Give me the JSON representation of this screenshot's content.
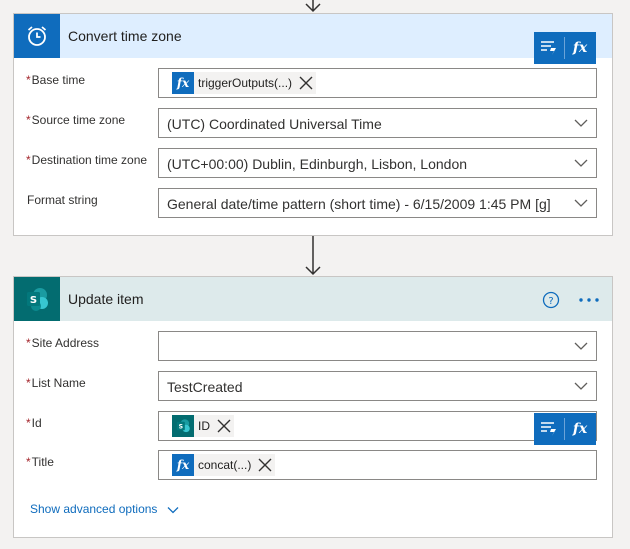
{
  "convert": {
    "title": "Convert time zone",
    "icon": "alarm-clock-icon",
    "accent": "#0f6cbd",
    "header_bg": "#deeeff",
    "fields": {
      "base_time": {
        "label": "Base time",
        "token": "triggerOutputs(...)"
      },
      "source_tz": {
        "label": "Source time zone",
        "value": "(UTC) Coordinated Universal Time"
      },
      "dest_tz": {
        "label": "Destination time zone",
        "value": "(UTC+00:00) Dublin, Edinburgh, Lisbon, London"
      },
      "format": {
        "label": "Format string",
        "value": "General date/time pattern (short time) - 6/15/2009 1:45 PM [g]"
      }
    }
  },
  "update": {
    "title": "Update item",
    "icon": "sharepoint-icon",
    "accent": "#036c70",
    "header_bg": "#ddeaeb",
    "help_icon": "help-icon",
    "more_icon": "more-icon",
    "fields": {
      "site": {
        "label": "Site Address",
        "value": ""
      },
      "list": {
        "label": "List Name",
        "value": "TestCreated"
      },
      "id": {
        "label": "Id",
        "token": "ID"
      },
      "title": {
        "label": "Title",
        "token": "concat(...)"
      }
    },
    "advanced": "Show advanced options"
  },
  "popup": {
    "dynamic_icon": "dynamic-content-icon",
    "fx_label": "fx"
  },
  "required_mark": "*"
}
